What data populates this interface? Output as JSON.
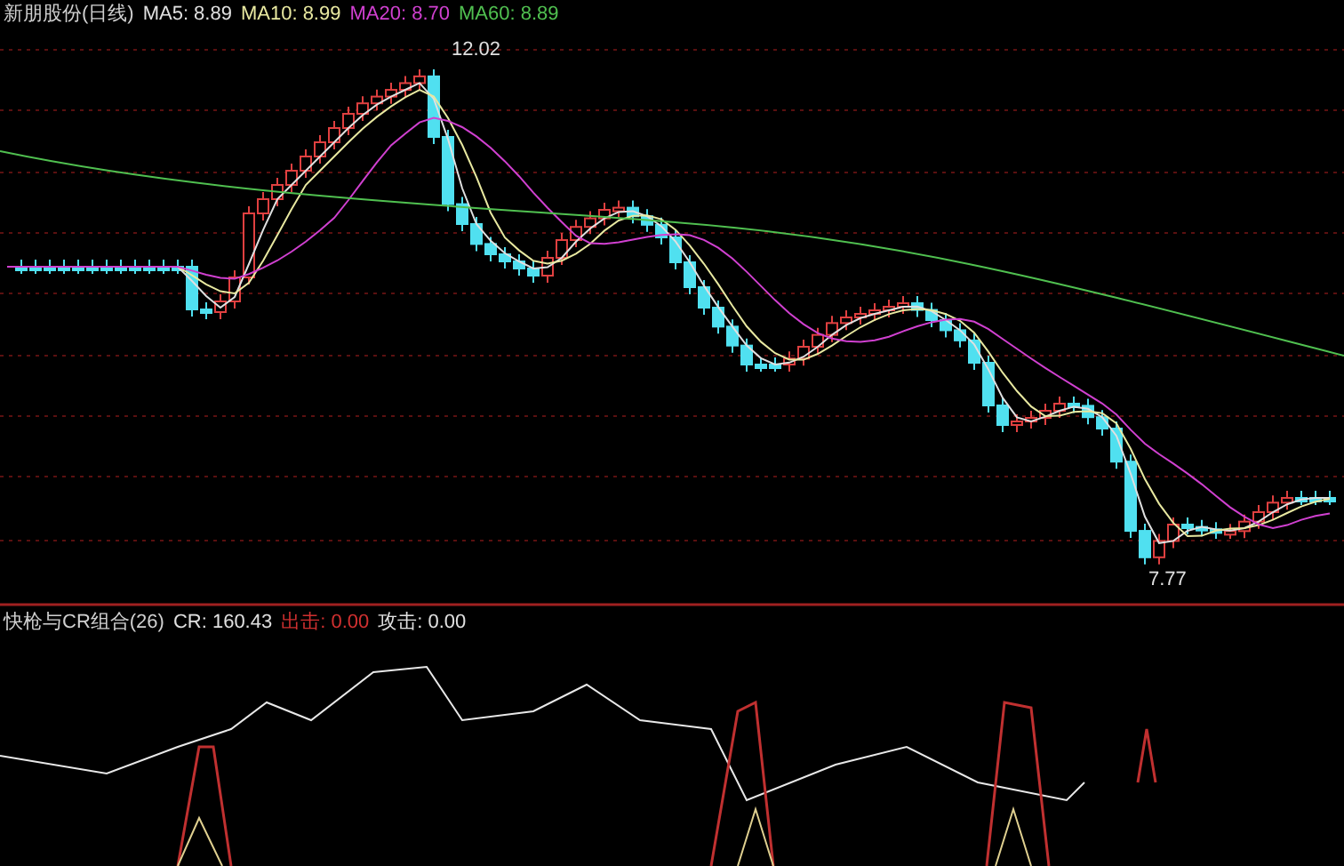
{
  "price_panel": {
    "title": "新朋股份(日线)",
    "indicators": [
      {
        "label": "MA5:",
        "value": "8.89",
        "color": "#e0e0e0"
      },
      {
        "label": "MA10:",
        "value": "8.99",
        "color": "#e8e8a0"
      },
      {
        "label": "MA20:",
        "value": "8.70",
        "color": "#d040d0"
      },
      {
        "label": "MA60:",
        "value": "8.89",
        "color": "#50c050"
      }
    ],
    "high_label": "12.02",
    "low_label": "7.77"
  },
  "indicator_panel": {
    "title": "快枪与CR组合(26)",
    "readings": [
      {
        "label": "CR:",
        "value": "160.43",
        "color": "#e0e0e0"
      },
      {
        "label": "出击:",
        "value": "0.00",
        "color": "#d03030"
      },
      {
        "label": "攻击:",
        "value": "0.00",
        "color": "#e0e0e0"
      }
    ]
  }
}
